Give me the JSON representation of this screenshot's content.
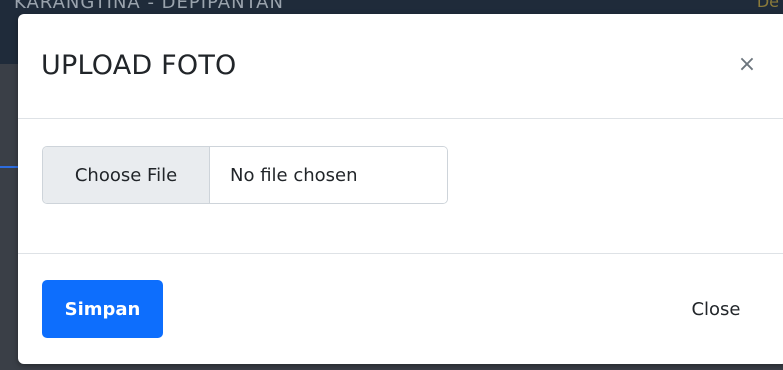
{
  "background": {
    "header_text": "KARANGTINA - DEPIPANTAN",
    "right_text": "De"
  },
  "modal": {
    "title": "UPLOAD FOTO",
    "close_icon": "×",
    "file_input": {
      "button_label": "Choose File",
      "status_text": "No file chosen"
    },
    "footer": {
      "save_label": "Simpan",
      "close_label": "Close"
    }
  },
  "colors": {
    "primary": "#0d6efd",
    "overlay": "#3a3f47",
    "border": "#dee2e6"
  }
}
